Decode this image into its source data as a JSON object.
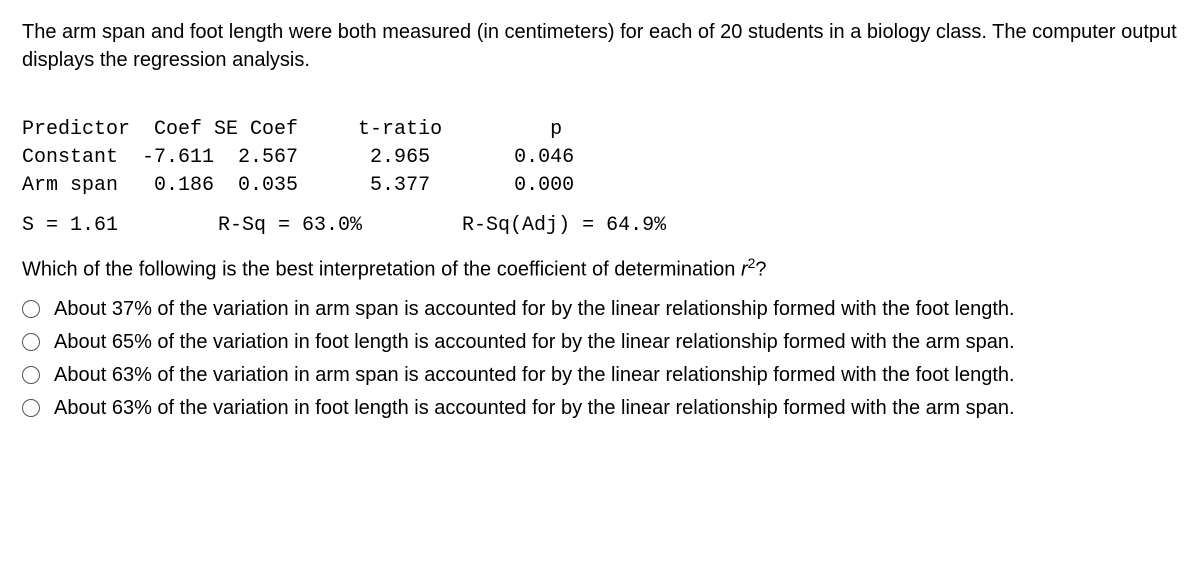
{
  "intro": "The arm span and foot length were both measured (in centimeters) for each of 20 students in a biology class. The computer output displays the regression analysis.",
  "table": {
    "header": "Predictor  Coef SE Coef     t-ratio         p",
    "row1": "Constant  -7.611  2.567      2.965       0.046",
    "row2": "Arm span   0.186  0.035      5.377       0.000"
  },
  "summary": {
    "s": "S = 1.61",
    "rsq": "R-Sq = 63.0%",
    "rsq_adj": "R-Sq(Adj) = 64.9%"
  },
  "question_prefix": "Which of the following is the best interpretation of the coefficient of determination ",
  "question_suffix": "?",
  "options": [
    "About 37% of the variation in arm span is accounted for by the linear relationship formed with the foot length.",
    "About 65% of the variation in foot length is accounted for by the linear relationship formed with the arm span.",
    "About 63% of the variation in arm span is accounted for by the linear relationship formed with the foot length.",
    "About 63% of the variation in foot length is accounted for by the linear relationship formed with the arm span."
  ]
}
